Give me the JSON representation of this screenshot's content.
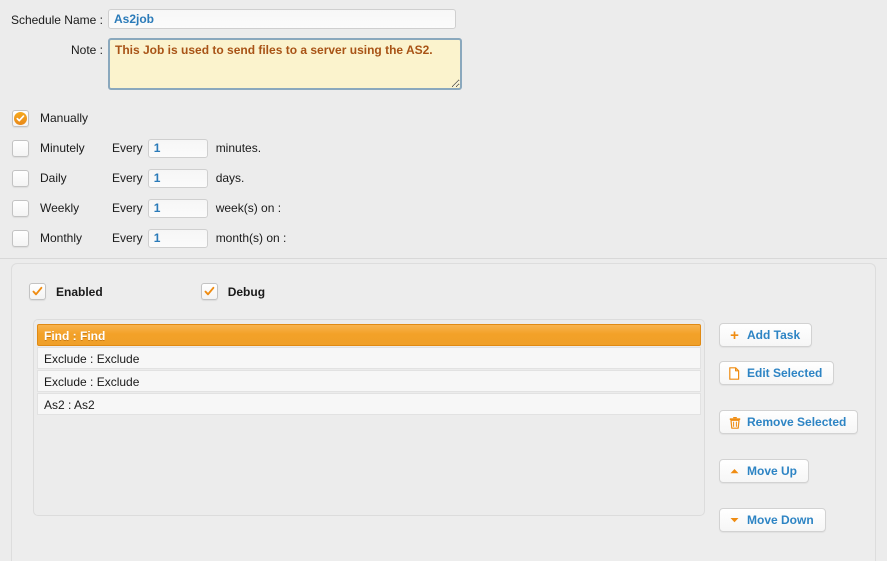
{
  "form": {
    "schedule_name_label": "Schedule Name :",
    "schedule_name_value": "As2job",
    "note_label": "Note :",
    "note_value": "This Job is used to send files to a server using the AS2."
  },
  "schedule": {
    "rows": [
      {
        "name": "Manually",
        "selected": true,
        "every_label": "",
        "value": "",
        "unit": ""
      },
      {
        "name": "Minutely",
        "selected": false,
        "every_label": "Every",
        "value": "1",
        "unit": "minutes."
      },
      {
        "name": "Daily",
        "selected": false,
        "every_label": "Every",
        "value": "1",
        "unit": "days."
      },
      {
        "name": "Weekly",
        "selected": false,
        "every_label": "Every",
        "value": "1",
        "unit": "week(s) on :"
      },
      {
        "name": "Monthly",
        "selected": false,
        "every_label": "Every",
        "value": "1",
        "unit": "month(s) on :"
      }
    ]
  },
  "panel": {
    "enabled_label": "Enabled",
    "enabled_checked": true,
    "debug_label": "Debug",
    "debug_checked": true,
    "tasks": [
      {
        "label": "Find : Find",
        "selected": true
      },
      {
        "label": "Exclude : Exclude",
        "selected": false
      },
      {
        "label": "Exclude : Exclude",
        "selected": false
      },
      {
        "label": "As2 : As2",
        "selected": false
      }
    ],
    "buttons": [
      {
        "label": "Add Task",
        "icon": "plus-icon"
      },
      {
        "label": "Edit Selected",
        "icon": "document-icon"
      },
      {
        "label": "Remove Selected",
        "icon": "trash-icon"
      },
      {
        "label": "Move Up",
        "icon": "triangle-up-icon"
      },
      {
        "label": "Move Down",
        "icon": "triangle-down-icon"
      }
    ]
  },
  "colors": {
    "accent_orange": "#ef8c12",
    "link_blue": "#2d84c4",
    "input_blue": "#2b7bb9",
    "note_text": "#a85316",
    "note_bg": "#fbf3cd",
    "page_bg": "#ececec"
  }
}
